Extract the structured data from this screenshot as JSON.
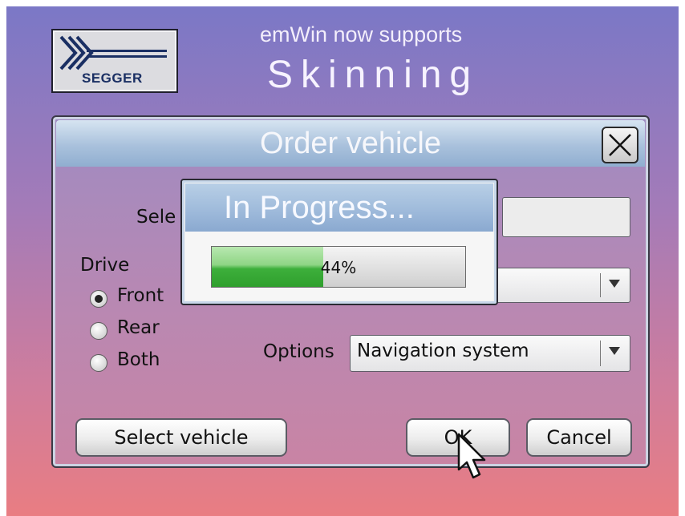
{
  "banner": {
    "logo_text": "SEGGER",
    "headline_small": "emWin now supports",
    "headline_big": "Skinning"
  },
  "dialog": {
    "title": "Order vehicle",
    "close_icon": "close-icon",
    "select_label_partial": "Sele",
    "drive": {
      "label": "Drive",
      "options": [
        "Front",
        "Rear",
        "Both"
      ],
      "selected": "Front"
    },
    "options_label": "Options",
    "options_value": "Navigation system",
    "buttons": {
      "select_vehicle": "Select vehicle",
      "ok": "OK",
      "cancel": "Cancel"
    }
  },
  "progress": {
    "title": "In Progress...",
    "percent_text": "44%",
    "value": 0.44
  },
  "colors": {
    "progress_fill": "#3daf3b",
    "title_bar": "#9db9da"
  }
}
